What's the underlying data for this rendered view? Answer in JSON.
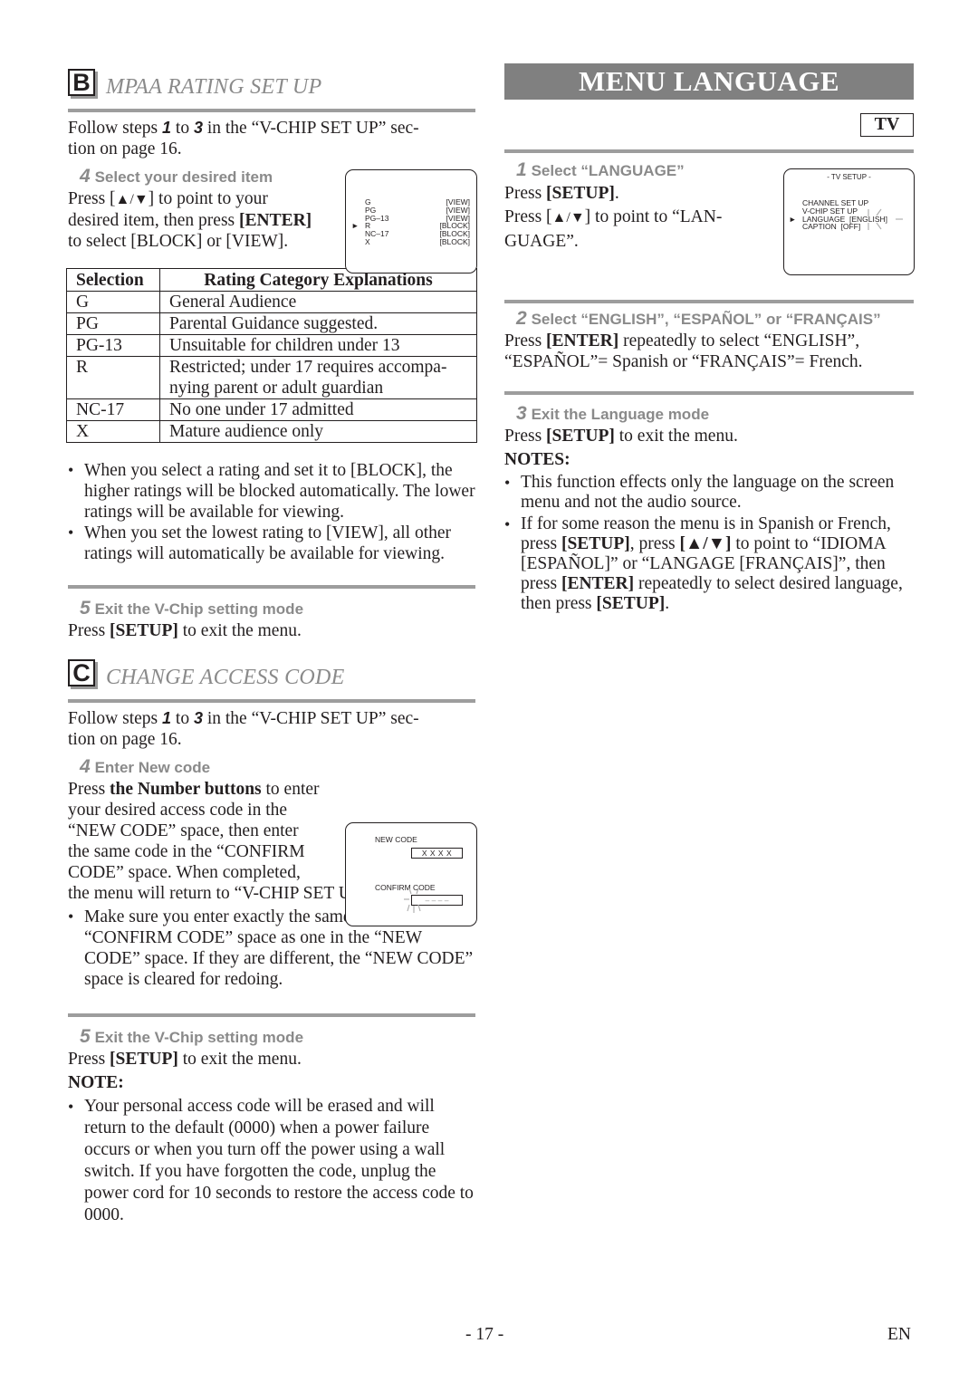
{
  "section_b": {
    "letter": "B",
    "title": "MPAA RATING SET UP",
    "intro_pre": "Follow steps ",
    "intro_step_from": "1",
    "intro_mid": " to ",
    "intro_step_to": "3",
    "intro_post_line1": " in the “V-CHIP SET UP” sec-",
    "intro_line2": "tion on page 16.",
    "step4": {
      "num": "4",
      "title": "Select your desired item",
      "line1_pre": "Press [",
      "line1_arrows": "▲/▼",
      "line1_post": "] to point to your",
      "line2_pre": "desired item, then press ",
      "line2_bold": "[ENTER]",
      "line3": "to select [BLOCK] or [VIEW]."
    },
    "osd": {
      "rows": [
        {
          "rating": "G",
          "status": "[VIEW]"
        },
        {
          "rating": "PG",
          "status": "[VIEW]"
        },
        {
          "rating": "PG–13",
          "status": "[VIEW]"
        },
        {
          "rating": "R",
          "status": "[BLOCK]"
        },
        {
          "rating": "NC–17",
          "status": "[BLOCK]"
        },
        {
          "rating": "X",
          "status": "[BLOCK]"
        }
      ],
      "pointer": "►",
      "selected_index": 3
    },
    "table": {
      "headers": [
        "Selection",
        "Rating Category Explanations"
      ],
      "rows": [
        [
          "G",
          "General Audience"
        ],
        [
          "PG",
          "Parental Guidance suggested."
        ],
        [
          "PG-13",
          "Unsuitable for children under 13"
        ],
        [
          "R",
          "Restricted; under 17 requires accompa-\nnying parent or adult guardian"
        ],
        [
          "NC-17",
          "No one under 17 admitted"
        ],
        [
          "X",
          "Mature audience only"
        ]
      ]
    },
    "bullets": [
      "When you select a rating and set it to [BLOCK], the higher ratings will be blocked automatically. The lower ratings will be available for viewing.",
      "When you set the lowest rating to [VIEW], all other ratings will automatically be available for viewing."
    ],
    "step5": {
      "num": "5",
      "title": "Exit the V-Chip setting mode",
      "text_pre": "Press ",
      "text_bold": "[SETUP]",
      "text_post": " to exit the menu."
    }
  },
  "section_c": {
    "letter": "C",
    "title": "CHANGE ACCESS CODE",
    "intro_pre": "Follow steps ",
    "intro_step_from": "1",
    "intro_mid": " to ",
    "intro_step_to": "3",
    "intro_post_line1": " in the “V-CHIP SET UP” sec-",
    "intro_line2": "tion on page 16.",
    "step4": {
      "num": "4",
      "title": "Enter New code",
      "line1_pre": "Press ",
      "line1_bold": "the Number buttons",
      "line1_post": " to enter",
      "line2": "your desired access code in the",
      "line3": "“NEW CODE” space, then enter",
      "line4": "the same code in the “CONFIRM",
      "line5": "CODE” space. When completed,",
      "line6": "the menu will return to “V-CHIP SET UP”."
    },
    "osd": {
      "new_code_label": "NEW CODE",
      "new_code_value": "X X X X",
      "confirm_label": "CONFIRM CODE",
      "confirm_value": "– – – –"
    },
    "bullets": [
      "Make sure you enter exactly the same new code in the “CONFIRM CODE” space as one in the “NEW CODE” space. If they are different, the “NEW CODE” space is cleared for redoing."
    ],
    "step5": {
      "num": "5",
      "title": "Exit the V-Chip setting mode",
      "text_pre": "Press ",
      "text_bold": "[SETUP]",
      "text_post": " to exit the menu."
    },
    "note_heading": "NOTE:",
    "note_bullets": [
      "Your personal access code will be erased and will return to the default (0000) when a power failure occurs or when you turn off the power using a wall switch. If you have forgotten the code, unplug the power cord for 10 seconds to restore the access code to 0000."
    ]
  },
  "menu_language": {
    "banner": "MENU LANGUAGE",
    "badge": "TV",
    "step1": {
      "num": "1",
      "title": "Select “LANGUAGE”",
      "line1_pre": "Press ",
      "line1_bold": "[SETUP]",
      "line1_post": ".",
      "line2_pre": "Press [",
      "line2_arrows": "▲/▼",
      "line2_post": "] to point to “LAN-",
      "line3": "GUAGE”."
    },
    "osd": {
      "title": "- TV SETUP -",
      "items": [
        "CHANNEL SET UP",
        "V-CHIP SET UP",
        "LANGUAGE  [ENGLISH]",
        "CAPTION  [OFF]"
      ],
      "pointer": "►",
      "selected_index": 2
    },
    "step2": {
      "num": "2",
      "title": "Select “ENGLISH”, “ESPAÑOL” or “FRANÇAIS”",
      "line1_pre": "Press ",
      "line1_bold": "[ENTER]",
      "line1_post": " repeatedly to select “ENGLISH”,",
      "line2": "“ESPAÑOL”= Spanish or “FRANÇAIS”= French."
    },
    "step3": {
      "num": "3",
      "title": "Exit the Language mode",
      "text_pre": "Press ",
      "text_bold": "[SETUP]",
      "text_post": " to exit the menu."
    },
    "notes_heading": "NOTES:",
    "note1": "This function effects only the language on the screen menu and not the audio source.",
    "note2": {
      "t1": "If for some reason the menu is in Spanish or French, press ",
      "b1": "[SETUP]",
      "t2": ", press ",
      "b2": "[▲/▼]",
      "t3": " to point to “IDIOMA [ESPAÑOL]” or “LANGAGE [FRANÇAIS]”, then press ",
      "b3": "[ENTER]",
      "t4": " repeatedly to select desired language, then press ",
      "b4": "[SETUP]",
      "t5": "."
    }
  },
  "footer": {
    "page": "- 17 -",
    "lang": "EN"
  }
}
